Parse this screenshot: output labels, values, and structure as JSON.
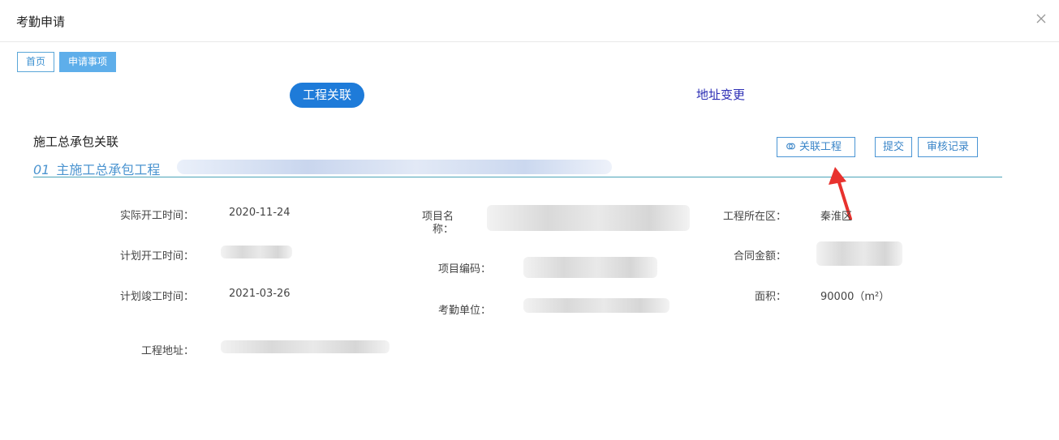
{
  "window": {
    "title": "考勤申请"
  },
  "breadcrumb": [
    {
      "label": "首页"
    },
    {
      "label": "申请事项"
    }
  ],
  "tabs": [
    {
      "label": "工程关联",
      "active": true
    },
    {
      "label": "地址变更",
      "active": false
    }
  ],
  "section": {
    "title": "施工总承包关联",
    "item_number": "01",
    "item_label": "主施工总承包工程"
  },
  "actions": {
    "link_project": "关联工程",
    "submit": "提交",
    "review_records": "审核记录"
  },
  "fields": {
    "actual_start": {
      "label": "实际开工时间：",
      "value": "2020-11-24"
    },
    "planned_start": {
      "label": "计划开工时间："
    },
    "planned_completion": {
      "label": "计划竣工时间：",
      "value": "2021-03-26"
    },
    "address": {
      "label": "工程地址："
    },
    "project_name": {
      "label_line1": "项目名",
      "label_line2": "称："
    },
    "project_code": {
      "label": "项目编码："
    },
    "attendance_unit": {
      "label": "考勤单位："
    },
    "district": {
      "label": "工程所在区：",
      "value": "秦淮区"
    },
    "contract_amount": {
      "label": "合同金额："
    },
    "area": {
      "label": "面积：",
      "value": "90000（m²）"
    }
  },
  "colors": {
    "accent": "#1e7bd9",
    "link_text": "#4b94d0",
    "annotation_arrow": "#e8322e"
  }
}
